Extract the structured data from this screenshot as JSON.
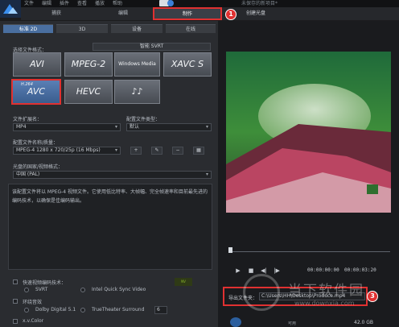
{
  "topbar": {
    "menu": [
      "文件",
      "编辑",
      "插件",
      "查看",
      "播放",
      "帮助"
    ],
    "document_title": "未保存的新项目*"
  },
  "modes": {
    "capture": "捕获",
    "edit": "编辑",
    "produce": "制作",
    "disc": "创建光盘"
  },
  "left": {
    "tabs": [
      "标准 2D",
      "3D",
      "设备",
      "在线"
    ],
    "svrt_label": "智能 SVRT",
    "select_format_label": "选择文件格式：",
    "formats": {
      "avi": "AVI",
      "mpeg2": "MPEG-2",
      "wm": "Windows Media",
      "xavc": "XAVC S",
      "avc_super": "H.264",
      "avc": "AVC",
      "hevc": "HEVC",
      "audio": "♪♪"
    },
    "ext_label": "文件扩展名：",
    "ext_value": "MP4",
    "profile_type_label": "配置文件类型：",
    "profile_type_value": "默认",
    "profile_label": "配置文件名称/质量：",
    "profile_value": "MPEG-4 1280 x 720/25p (16 Mbps)",
    "region_label": "光盘的国家/视频格式：",
    "region_value": "中国 (PAL)",
    "description": "该配置文件将以 MPEG-4 视频文件。它使用低比特率、大帧幅、完全帧速率和目前最先进的编码技术，以确保是佳编码输出。",
    "fast_render_label": "快速视频编码技术：",
    "svrt_option": "SVRT",
    "intel_option": "Intel Quick Sync Video",
    "surround_label": "环绕音效",
    "dolby_option": "Dolby Digital 5.1",
    "truetheater_option": "TrueTheater Surround",
    "truetheater_value": "6",
    "xvcolor_label": "x.v.Color"
  },
  "right": {
    "timecode_current": "00:00:00:00",
    "timecode_total": "00:00:03:20",
    "output_label": "导出文件夹：",
    "output_path": "C:\\Users\\HH\\Desktop\\Produce.mp4",
    "disk_available": "可用",
    "disk_size": "42.0 GB"
  },
  "annotations": {
    "badge1": "1",
    "badge2": "2",
    "badge3": "3"
  },
  "watermark": {
    "cn": "当下软件园",
    "url": "www.downxia.com"
  },
  "colors": {
    "accent": "#4a6fa0",
    "annotation_red": "#e03131",
    "background": "#1c1c1e"
  }
}
